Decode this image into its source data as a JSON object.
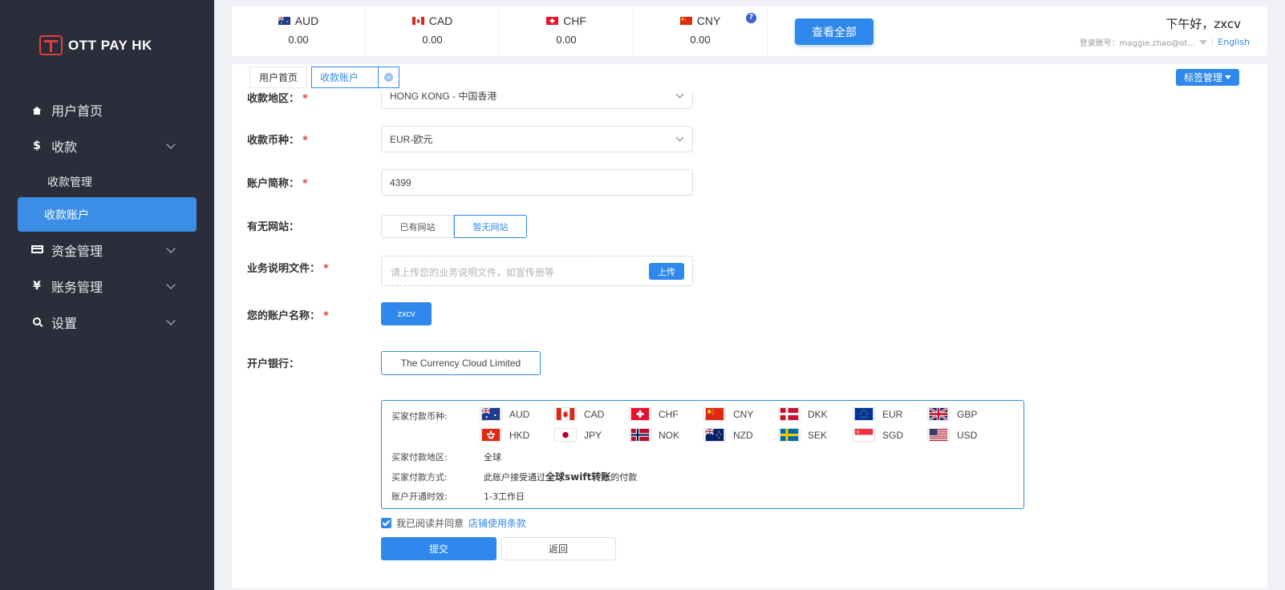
{
  "brand": {
    "name": "OTT PAY HK"
  },
  "sidebar": {
    "items": [
      {
        "label": "用户首页",
        "icon": "home-icon"
      },
      {
        "label": "收款",
        "icon": "dollar-icon",
        "glyph": "$"
      },
      {
        "label": "资金管理",
        "icon": "card-icon"
      },
      {
        "label": "账务管理",
        "icon": "yen-icon",
        "glyph": "¥"
      },
      {
        "label": "设置",
        "icon": "search-icon"
      }
    ],
    "sub_items": [
      {
        "label": "收款管理"
      },
      {
        "label": "收款账户"
      }
    ]
  },
  "balances": [
    {
      "code": "AUD",
      "value": "0.00"
    },
    {
      "code": "CAD",
      "value": "0.00"
    },
    {
      "code": "CHF",
      "value": "0.00"
    },
    {
      "code": "CNY",
      "value": "0.00"
    }
  ],
  "header": {
    "help": "?",
    "view_all": "查看全部",
    "greeting": "下午好，zxcv",
    "login_account": "登录账号：maggie.zhao@ot...",
    "language": "English"
  },
  "tabs": {
    "home": "用户首页",
    "active": "收款账户",
    "close": "×",
    "tag_manage": "标签管理"
  },
  "form": {
    "region_label": "收款地区：",
    "region_value": "HONG KONG - 中国香港",
    "currency_label": "收款币种：",
    "currency_value": "EUR-欧元",
    "alias_label": "账户简称：",
    "alias_value": "4399",
    "website_label": "有无网站：",
    "website_options": [
      "已有网站",
      "暂无网站"
    ],
    "doc_label": "业务说明文件：",
    "doc_placeholder": "请上传您的业务说明文件，如宣传册等",
    "upload": "上传",
    "account_name_label": "您的账户名称：",
    "account_name_value": "zxcv",
    "bank_label": "开户银行：",
    "bank_value": "The Currency Cloud Limited",
    "required_mark": "*"
  },
  "info": {
    "payer_currency_label": "买家付款币种:",
    "payer_region_label": "买家付款地区:",
    "payer_region_value": "全球",
    "payer_method_label": "买家付款方式:",
    "payer_method_prefix": "此账户接受通过",
    "payer_method_bold": "全球swift转账",
    "payer_method_suffix": "的付款",
    "open_time_label": "账户开通时效:",
    "open_time_value": "1-3工作日",
    "currencies": [
      "AUD",
      "CAD",
      "CHF",
      "CNY",
      "DKK",
      "EUR",
      "GBP",
      "HKD",
      "JPY",
      "NOK",
      "NZD",
      "SEK",
      "SGD",
      "USD"
    ]
  },
  "agreement": {
    "text": "我已阅读并同意",
    "link": "店铺使用条款"
  },
  "actions": {
    "submit": "提交",
    "back": "返回"
  },
  "colors": {
    "sidebar_bg": "#2b2d3a",
    "accent": "#2f89ec",
    "required": "#e23d3d"
  }
}
